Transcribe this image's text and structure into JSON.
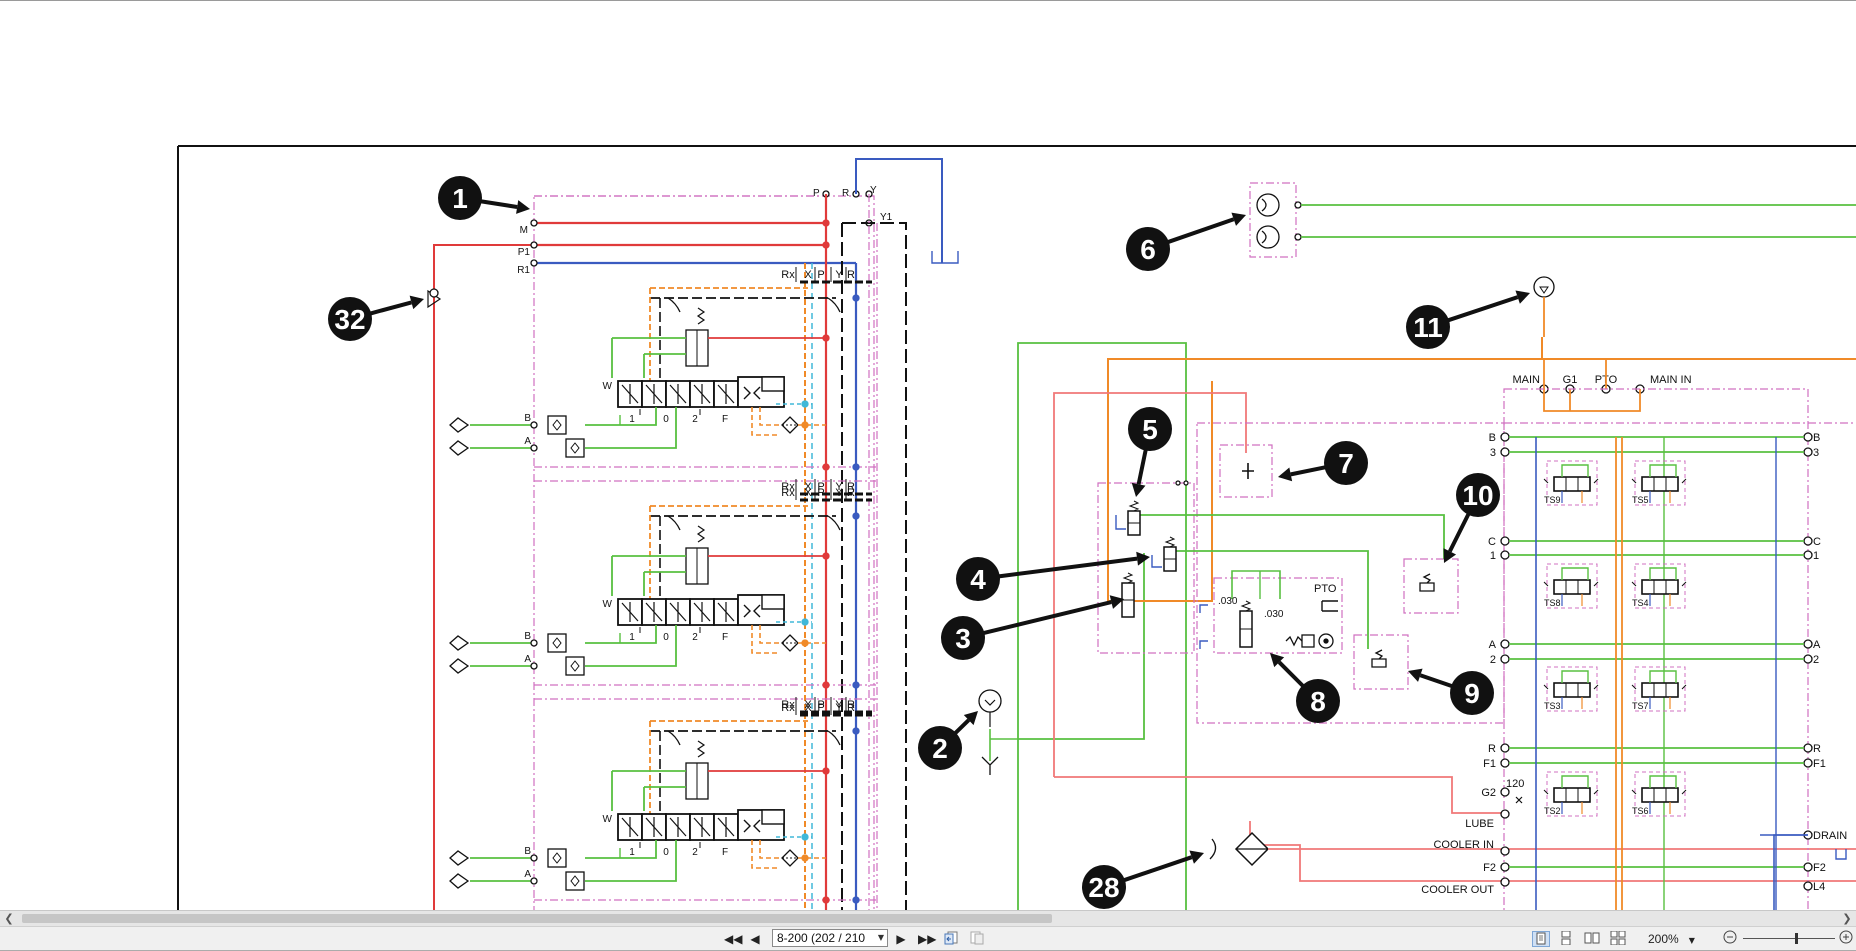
{
  "document": {
    "callouts": [
      "1",
      "2",
      "3",
      "4",
      "5",
      "6",
      "7",
      "8",
      "9",
      "10",
      "11",
      "28",
      "32"
    ],
    "valve_bank_labels": {
      "ports_top": [
        "P",
        "R",
        "Y",
        "M",
        "P1",
        "R1",
        "Y1"
      ],
      "header": [
        "Rx",
        "X",
        "P",
        "Y",
        "R"
      ],
      "positions": [
        "1",
        "0",
        "2",
        "F"
      ],
      "side": [
        "B",
        "A"
      ],
      "w": "W"
    },
    "manifold_labels": {
      "top": [
        "MAIN",
        "G1",
        "PTO",
        "MAIN IN"
      ],
      "left_ports": [
        "B",
        "3",
        "C",
        "1",
        "A",
        "2",
        "R",
        "F1",
        "G2",
        "F2"
      ],
      "right_ports": [
        "B",
        "3",
        "C",
        "1",
        "A",
        "2",
        "R",
        "F1",
        "DRAIN",
        "F2",
        "L4"
      ],
      "text_ports": [
        "LUBE",
        "COOLER IN",
        "COOLER OUT"
      ],
      "orifice": "120",
      "solenoids": [
        "TS9",
        "TS5",
        "TS8",
        "TS4",
        "TS3",
        "TS7",
        "TS2",
        "TS6"
      ]
    },
    "control_labels": {
      "pto": "PTO",
      "orifice_a": ".030",
      "orifice_b": ".030"
    }
  },
  "statusbar": {
    "page_value": "8-200 (202 / 210",
    "zoom": "200%"
  }
}
